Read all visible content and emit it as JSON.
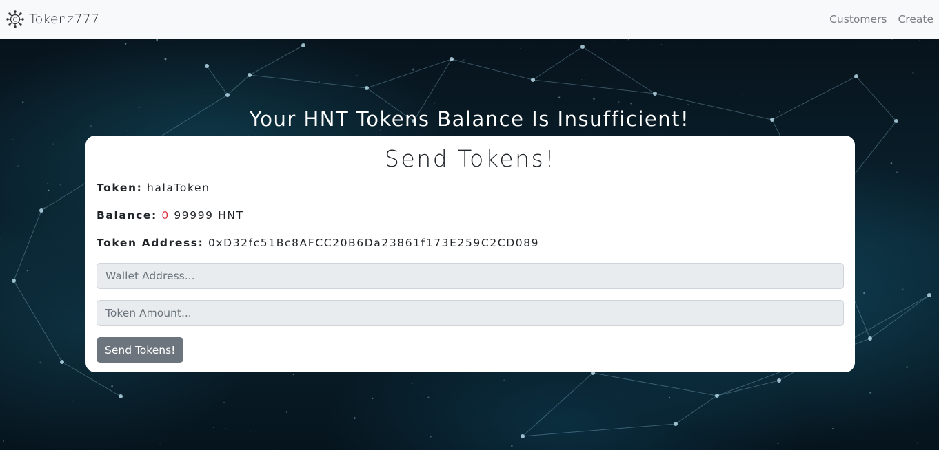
{
  "navbar": {
    "brand": "Tokenz777",
    "brand_icon": "network-coin-icon",
    "links": [
      {
        "label": "Customers"
      },
      {
        "label": "Create"
      }
    ]
  },
  "hero": {
    "background": "particle-network",
    "headline": "Your HNT Tokens Balance Is Insufficient!"
  },
  "card": {
    "title": "Send Tokens!",
    "token_label": "Token:",
    "token_value": "halaToken",
    "balance_label": "Balance:",
    "balance_amount": "0",
    "balance_rest": "99999 HNT",
    "address_label": "Token Address:",
    "address_value": "0xD32fc51Bc8AFCC20B6Da23861f173E259C2CD089",
    "wallet_placeholder": "Wallet Address...",
    "wallet_value": "",
    "amount_placeholder": "Token Amount...",
    "amount_value": "",
    "send_button": "Send Tokens!"
  },
  "colors": {
    "navbar_bg": "#f8f9fa",
    "accent_red": "#dc3545",
    "button_bg": "#6c757d",
    "input_bg": "#e9ecef"
  }
}
